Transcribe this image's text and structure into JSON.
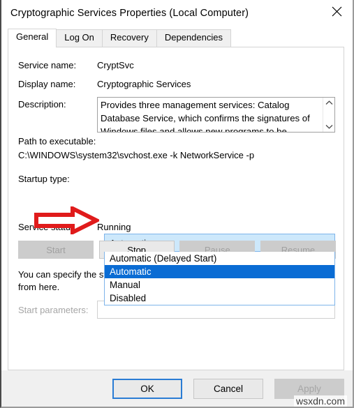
{
  "window": {
    "title": "Cryptographic Services Properties (Local Computer)",
    "close_icon": "close-icon"
  },
  "tabs": [
    {
      "label": "General",
      "active": true
    },
    {
      "label": "Log On",
      "active": false
    },
    {
      "label": "Recovery",
      "active": false
    },
    {
      "label": "Dependencies",
      "active": false
    }
  ],
  "general": {
    "service_name_label": "Service name:",
    "service_name_value": "CryptSvc",
    "display_name_label": "Display name:",
    "display_name_value": "Cryptographic Services",
    "description_label": "Description:",
    "description_value": "Provides three management services: Catalog Database Service, which confirms the signatures of Windows files and allows new programs to be",
    "path_label": "Path to executable:",
    "path_value": "C:\\WINDOWS\\system32\\svchost.exe -k NetworkService -p",
    "startup_type_label": "Startup type:",
    "startup_type_value": "Automatic",
    "startup_type_options": [
      "Automatic (Delayed Start)",
      "Automatic",
      "Manual",
      "Disabled"
    ],
    "startup_type_selected_index": 1,
    "service_status_label": "Service status:",
    "service_status_value": "Running",
    "control_buttons": [
      {
        "label": "Start",
        "enabled": false
      },
      {
        "label": "Stop",
        "enabled": true
      },
      {
        "label": "Pause",
        "enabled": false
      },
      {
        "label": "Resume",
        "enabled": false
      }
    ],
    "help_text": "You can specify the start parameters that apply when you start the service from here.",
    "start_parameters_label": "Start parameters:",
    "start_parameters_value": ""
  },
  "footer": {
    "ok_label": "OK",
    "cancel_label": "Cancel",
    "apply_label": "Apply",
    "apply_enabled": false
  },
  "annotation": {
    "arrow": "red-right-arrow",
    "color": "#e01b1b"
  },
  "watermark": "wsxdn.com"
}
